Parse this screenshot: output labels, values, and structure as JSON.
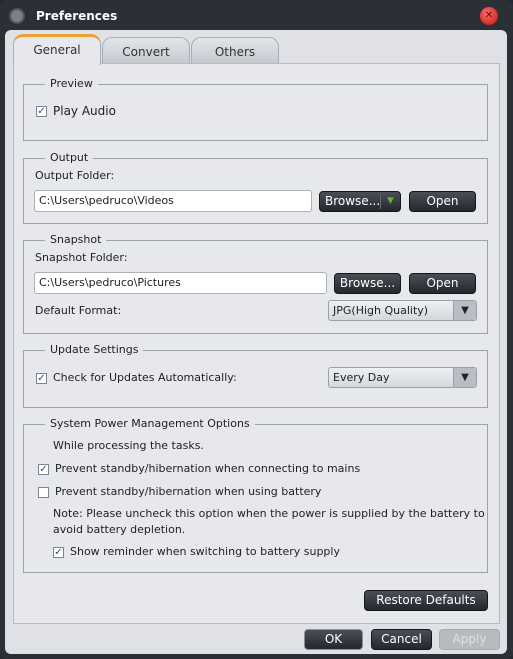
{
  "window": {
    "title": "Preferences",
    "icon": "film-reel-icon",
    "close_icon": "close-icon"
  },
  "tabs": [
    {
      "label": "General",
      "active": true
    },
    {
      "label": "Convert",
      "active": false
    },
    {
      "label": "Others",
      "active": false
    }
  ],
  "preview": {
    "legend": "Preview",
    "play_audio": {
      "label": "Play Audio",
      "checked": true
    }
  },
  "output": {
    "legend": "Output",
    "folder_label": "Output Folder:",
    "folder_value": "C:\\Users\\pedruco\\Videos",
    "browse_label": "Browse...",
    "open_label": "Open"
  },
  "snapshot": {
    "legend": "Snapshot",
    "folder_label": "Snapshot Folder:",
    "folder_value": "C:\\Users\\pedruco\\Pictures",
    "browse_label": "Browse...",
    "open_label": "Open",
    "format_label": "Default Format:",
    "format_value": "JPG(High Quality)"
  },
  "update": {
    "legend": "Update Settings",
    "check_label": "Check for Updates Automatically:",
    "checked": true,
    "frequency_value": "Every Day"
  },
  "power": {
    "legend": "System Power Management Options",
    "intro": "While processing the tasks.",
    "mains": {
      "label": "Prevent standby/hibernation when connecting to mains",
      "checked": true
    },
    "battery": {
      "label": "Prevent standby/hibernation when using battery",
      "checked": false
    },
    "note_line1": "Note: Please uncheck this option when the power is supplied by the battery to",
    "note_line2": "avoid battery depletion.",
    "reminder": {
      "label": "Show reminder when switching to battery supply",
      "checked": true
    }
  },
  "buttons": {
    "restore": "Restore Defaults",
    "ok": "OK",
    "cancel": "Cancel",
    "apply": "Apply",
    "apply_enabled": false
  },
  "check_glyph": "✓",
  "dropdown_glyph": "▼"
}
